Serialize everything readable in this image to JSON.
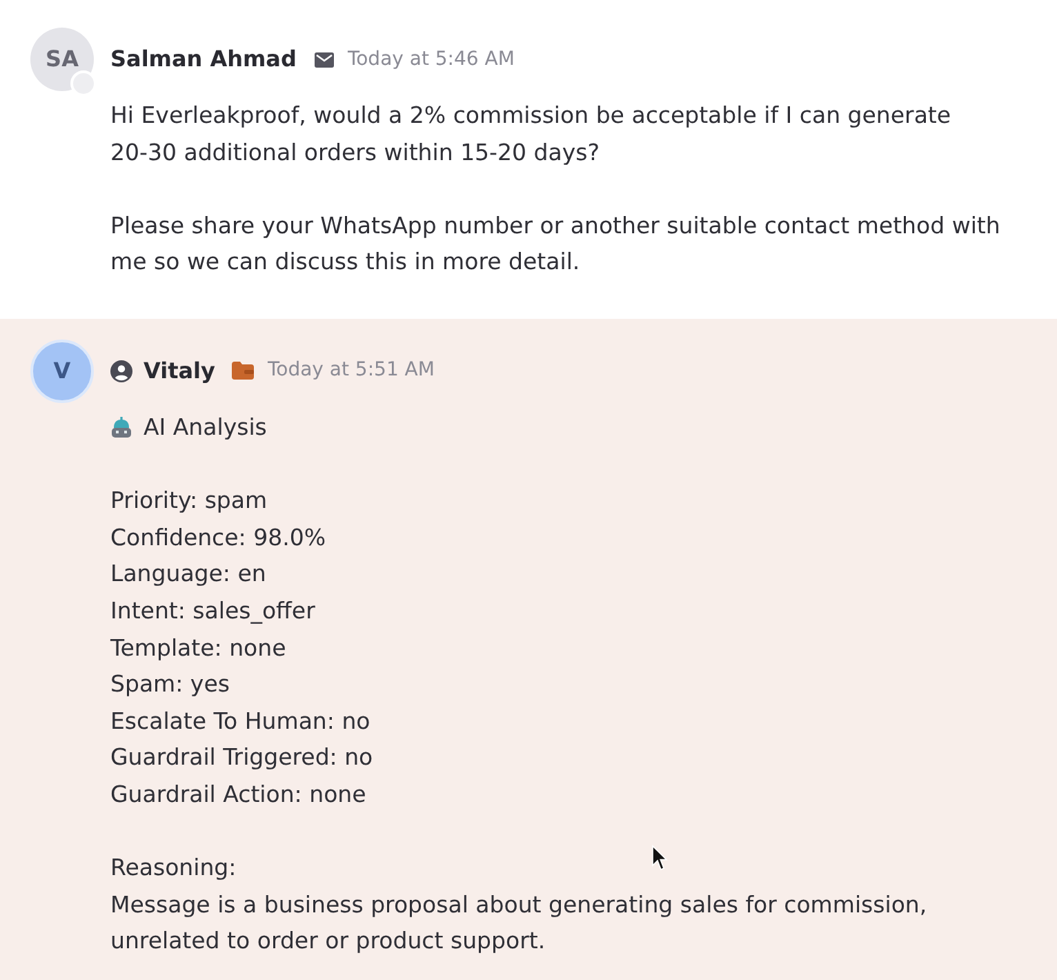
{
  "messages": [
    {
      "kind": "customer",
      "avatar": {
        "initials": "SA"
      },
      "sender": "Salman Ahmad",
      "timestamp": "Today at 5:46 AM",
      "paragraphs": [
        "Hi Everleakproof, would a 2% commission be acceptable if I can generate 20-30 additional orders within 15-20 days?",
        "Please share your WhatsApp number or another suitable contact method with me so we can discuss this in more detail."
      ]
    },
    {
      "kind": "agent",
      "avatar": {
        "initials": "V"
      },
      "sender": "Vitaly",
      "timestamp": "Today at 5:51 AM",
      "analysis": {
        "title": "AI Analysis",
        "fields": [
          "Priority: spam",
          "Confidence: 98.0%",
          "Language: en",
          "Intent: sales_offer",
          "Template: none",
          "Spam: yes",
          "Escalate To Human: no",
          "Guardrail Triggered: no",
          "Guardrail Action: none"
        ],
        "reasoning_label": "Reasoning:",
        "reasoning": "Message is a business proposal about generating sales for commission, unrelated to order or product support."
      }
    }
  ]
}
